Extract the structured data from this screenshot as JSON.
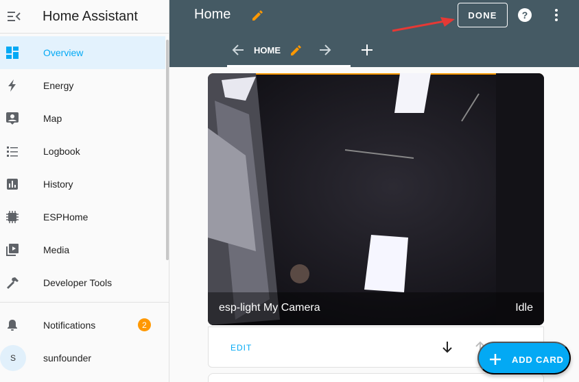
{
  "sidebar": {
    "title": "Home Assistant",
    "items": [
      {
        "label": "Overview",
        "icon": "overview-icon"
      },
      {
        "label": "Energy",
        "icon": "energy-icon"
      },
      {
        "label": "Map",
        "icon": "map-icon"
      },
      {
        "label": "Logbook",
        "icon": "logbook-icon"
      },
      {
        "label": "History",
        "icon": "history-icon"
      },
      {
        "label": "ESPHome",
        "icon": "esphome-icon"
      },
      {
        "label": "Media",
        "icon": "media-icon"
      },
      {
        "label": "Developer Tools",
        "icon": "hammer-icon"
      }
    ],
    "notifications": {
      "label": "Notifications",
      "count": "2"
    },
    "user": {
      "label": "sunfounder",
      "initial": "S"
    }
  },
  "header": {
    "title": "Home",
    "done_label": "DONE",
    "tab_label": "HOME"
  },
  "card": {
    "camera_name": "esp-light My Camera",
    "state": "Idle",
    "edit_label": "EDIT"
  },
  "fab": {
    "label": "ADD CARD"
  },
  "colors": {
    "accent": "#03a9f4",
    "header": "#455a64",
    "badge": "#ff9800",
    "pencil": "#ff9800",
    "arrow": "#e53935"
  }
}
